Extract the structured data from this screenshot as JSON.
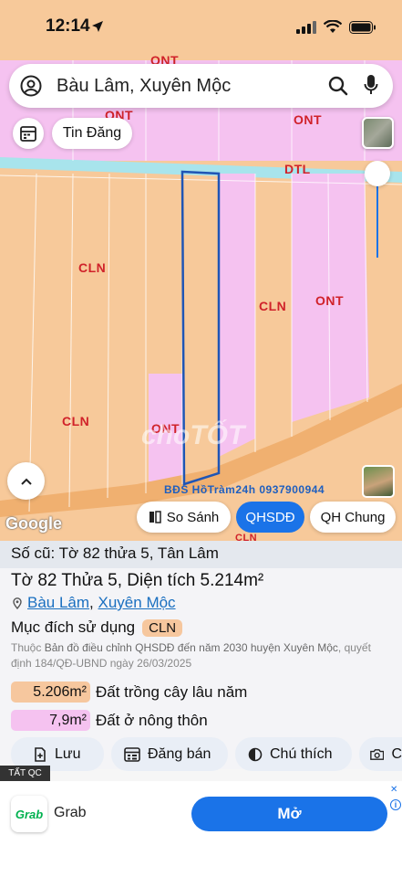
{
  "status": {
    "time": "12:14"
  },
  "search": {
    "query": "Bàu Lâm, Xuyên Mộc"
  },
  "map": {
    "tin_dang_label": "Tin Đăng",
    "zones": [
      "ONT",
      "ONT",
      "ONT",
      "DTL",
      "CLN",
      "CLN",
      "ONT",
      "CLN",
      "ONT",
      "CLN"
    ],
    "watermark": "choTỐT",
    "agent_label": "BĐS HồTràm24h 0937900944",
    "google": "Google",
    "buttons": {
      "compare": "So Sánh",
      "qhsdd": "QHSDĐ",
      "qh_chung": "QH Chung"
    }
  },
  "panel": {
    "old_ref": "Số cũ: Tờ 82 thửa 5, Tân Lâm",
    "title": "Tờ 82 Thửa 5, Diện tích 5.214m²",
    "location": {
      "commune": "Bàu Lâm",
      "separator": ",",
      "district": "Xuyên Mộc"
    },
    "purpose_label": "Mục đích sử dụng",
    "purpose_code": "CLN",
    "note_prefix": "Thuộc",
    "note_main": "Bản đồ điều chỉnh QHSDĐ đến năm 2030 huyện Xuyên Mộc",
    "note_suffix": ", quyết định 184/QĐ-UBND ngày 26/03/2025",
    "areas": [
      {
        "value": "5.206m²",
        "desc": "Đất trồng cây lâu năm",
        "color": "#f6c79e"
      },
      {
        "value": "7,9m²",
        "desc": "Đất ở nông thôn",
        "color": "#f5c2f0"
      }
    ],
    "actions": {
      "save": "Lưu",
      "post": "Đăng bán",
      "legend": "Chú thích",
      "capture": "C"
    }
  },
  "ad": {
    "tag": "TẤT QC",
    "logo": "Grab",
    "name": "Grab",
    "cta": "Mở"
  },
  "colors": {
    "cln": "#f7c99a",
    "ont": "#f5c2f0",
    "dtl": "#a8e4ec",
    "road": "#f0b070",
    "accent": "#1a73e8"
  }
}
